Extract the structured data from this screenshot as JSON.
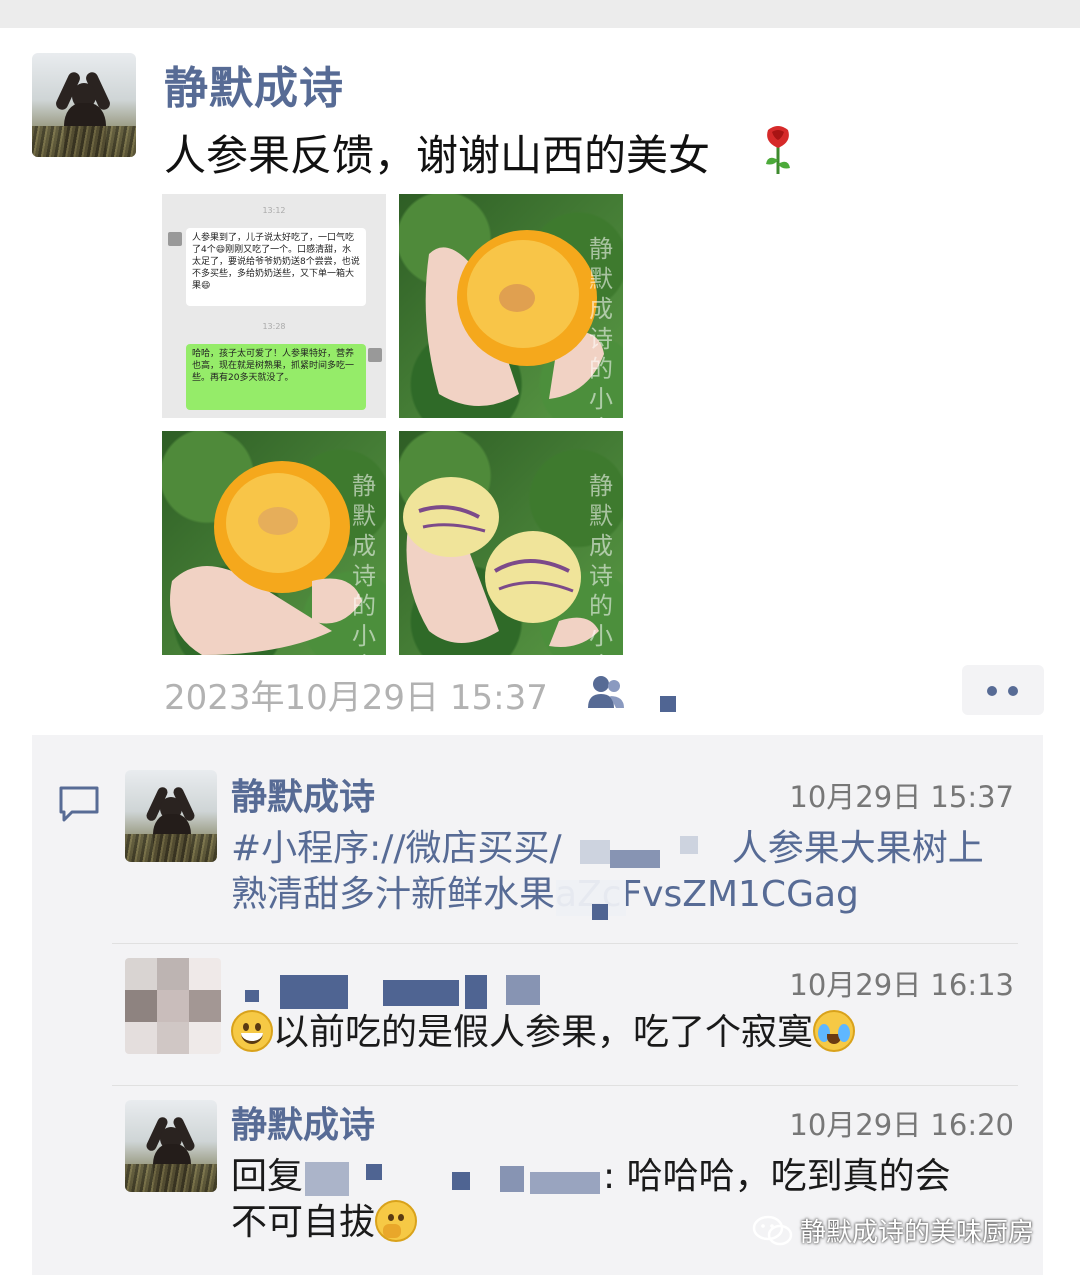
{
  "post": {
    "author": "静默成诗",
    "text": "人参果反馈，谢谢山西的美女",
    "timestamp": "2023年10月29日 15:37",
    "photos": [
      {
        "kind": "chat-screenshot",
        "times": [
          "13:12",
          "13:28"
        ],
        "incoming": "人参果到了，儿子说太好吃了，一口气吃了4个😄刚刚又吃了一个。口感清甜，水太足了，要说给爷爷奶奶送8个尝尝，也说不多买些，多给奶奶送些，又下单一箱大果😄",
        "outgoing": "哈哈，孩子太可爱了！人参果特好，营养也高，现在就是树熟果，抓紧时间多吃一些。再有20多天就没了。"
      },
      {
        "kind": "photo",
        "watermark": "静默成诗的小店"
      },
      {
        "kind": "photo",
        "watermark": "静默成诗的小店"
      },
      {
        "kind": "photo",
        "watermark": "静默成诗的小店"
      }
    ]
  },
  "comments": [
    {
      "author": "静默成诗",
      "time": "10月29日 15:37",
      "text_line1_prefix": "#小程序://微店买买/",
      "text_line1_suffix": "人参果大果树上",
      "text_line2_prefix": "熟清甜多汁新鲜水果",
      "text_line2_suffix": "aZcFvsZM1CGag"
    },
    {
      "author": "",
      "time": "10月29日 16:13",
      "text": "以前吃的是假人参果，吃了个寂寞"
    },
    {
      "author": "静默成诗",
      "time": "10月29日 16:20",
      "reply_prefix": "回复",
      "reply_suffix": ": 哈哈哈，吃到真的会",
      "line2": "不可自拔"
    }
  ],
  "footer": {
    "brand": "静默成诗的美味厨房"
  },
  "colors": {
    "link": "#576b95",
    "comment_bg": "#f3f3f5",
    "timestamp": "#b2b2b2"
  }
}
